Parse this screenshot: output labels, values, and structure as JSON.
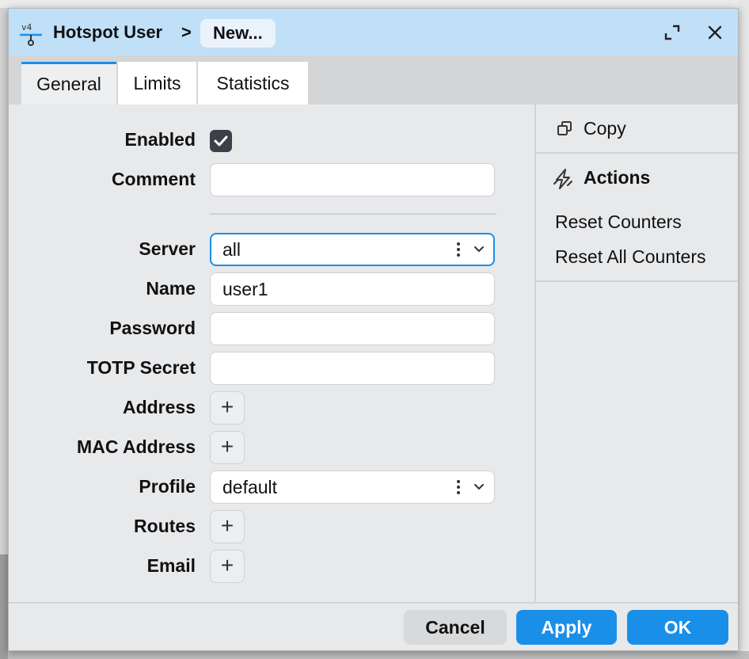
{
  "window": {
    "breadcrumb_root": "Hotspot User",
    "breadcrumb_separator": ">",
    "breadcrumb_current": "New...",
    "app_icon": "ipv4-network-icon",
    "restore_icon": "restore-window-icon",
    "close_icon": "close-icon"
  },
  "tabs": [
    {
      "label": "General",
      "active": true
    },
    {
      "label": "Limits",
      "active": false
    },
    {
      "label": "Statistics",
      "active": false
    }
  ],
  "form": {
    "enabled": {
      "label": "Enabled",
      "checked": true
    },
    "comment": {
      "label": "Comment",
      "value": ""
    },
    "server": {
      "label": "Server",
      "value": "all"
    },
    "name": {
      "label": "Name",
      "value": "user1"
    },
    "password": {
      "label": "Password",
      "value": ""
    },
    "totp_secret": {
      "label": "TOTP Secret",
      "value": ""
    },
    "address": {
      "label": "Address",
      "add": "+"
    },
    "mac_address": {
      "label": "MAC Address",
      "add": "+"
    },
    "profile": {
      "label": "Profile",
      "value": "default"
    },
    "routes": {
      "label": "Routes",
      "add": "+"
    },
    "email": {
      "label": "Email",
      "add": "+"
    }
  },
  "side": {
    "copy_label": "Copy",
    "actions_label": "Actions",
    "actions": [
      "Reset Counters",
      "Reset All Counters"
    ]
  },
  "footer": {
    "cancel": "Cancel",
    "apply": "Apply",
    "ok": "OK"
  },
  "colors": {
    "accent": "#1a8fe8",
    "titlebar": "#bfe0f6"
  }
}
